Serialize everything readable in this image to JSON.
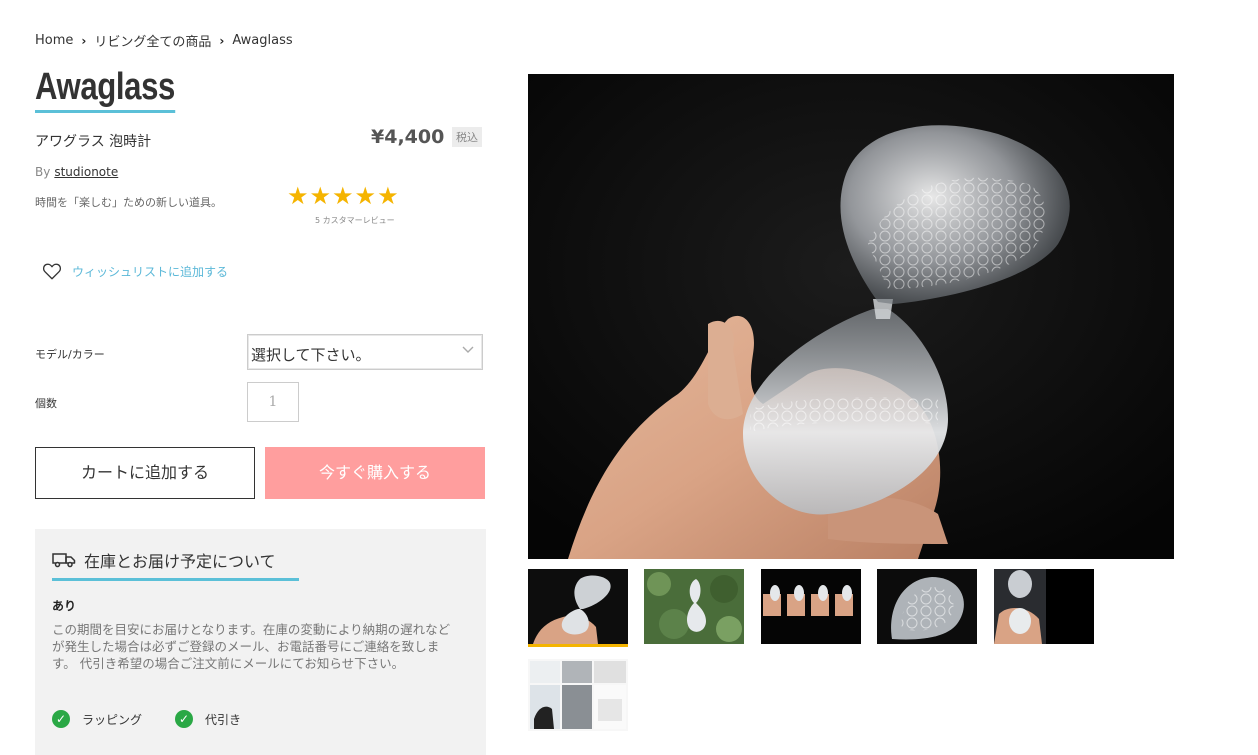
{
  "breadcrumb": {
    "home": "Home",
    "category": "リビング全ての商品",
    "current": "Awaglass"
  },
  "product": {
    "title": "Awaglass",
    "subtitle": "アワグラス 泡時計",
    "price": "¥4,400",
    "tax_label": "税込",
    "by_label": "By",
    "brand": "studionote",
    "tagline": "時間を「楽しむ」ための新しい道具。",
    "rating": 5,
    "rating_max": 5,
    "review_text": "5 カスタマーレビュー",
    "wishlist_label": "ウィッシュリストに追加する"
  },
  "options": {
    "model_label": "モデル/カラー",
    "model_placeholder": "選択して下さい。",
    "qty_label": "個数",
    "qty_value": "1"
  },
  "actions": {
    "add_to_cart": "カートに追加する",
    "buy_now": "今すぐ購入する"
  },
  "stock": {
    "heading": "在庫とお届け予定について",
    "status": "あり",
    "description": "この期間を目安にお届けとなります。在庫の変動により納期の遅れなどが発生した場合は必ずご登録のメール、お電話番号にご連絡を致します。 代引き希望の場合ご注文前にメールにてお知らせ下さい。",
    "features": [
      "ラッピング",
      "代引き"
    ]
  },
  "gallery": {
    "thumb_count": 6,
    "selected_index": 0
  },
  "colors": {
    "accent": "#5bc0d8",
    "buy_button": "#ff9e9e",
    "star": "#f5b400",
    "check": "#2aa845"
  }
}
